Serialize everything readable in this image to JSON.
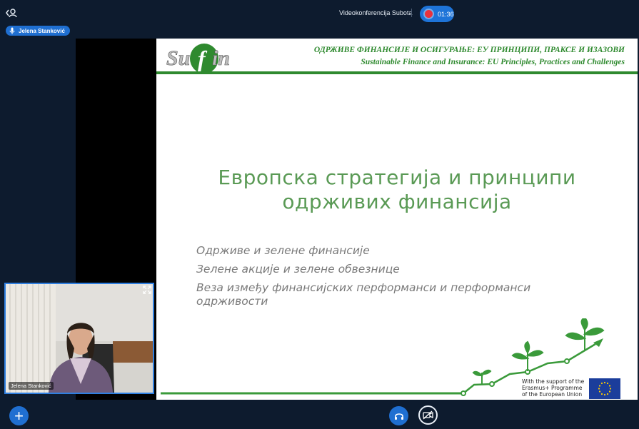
{
  "meeting": {
    "title": "Videokonferencija Subota",
    "timer": "01:36"
  },
  "speaker": {
    "name": "Jelena Stanković"
  },
  "video": {
    "participant_name": "Jelena Stanković"
  },
  "slide": {
    "logo_text": "Sufin",
    "header_sr": "ОДРЖИВЕ ФИНАНСИЈЕ И ОСИГУРАЊЕ: ЕУ ПРИНЦИПИ, ПРАКСЕ И ИЗАЗОВИ",
    "header_en": "Sustainable Finance and Insurance: EU Principles, Practices and Challenges",
    "title_line1": "Европска стратегија и принципи",
    "title_line2": "одрживих финансија",
    "bullets": [
      "Одрживе и зелене финансије",
      "Зелене акције и зелене обвезнице",
      "Веза између финансијских перформанси и перформанси одрживости"
    ],
    "erasmus_line1": "With the support of the",
    "erasmus_line2": "Erasmus+ Programme",
    "erasmus_line3": "of the European Union"
  },
  "colors": {
    "accent": "#1f6fd1",
    "slide_green": "#2f8a2f",
    "record": "#e9323d"
  },
  "icons": [
    "user-back-icon",
    "microphone-icon",
    "expand-icon",
    "plus-icon",
    "headphones-icon",
    "video-off-icon"
  ]
}
